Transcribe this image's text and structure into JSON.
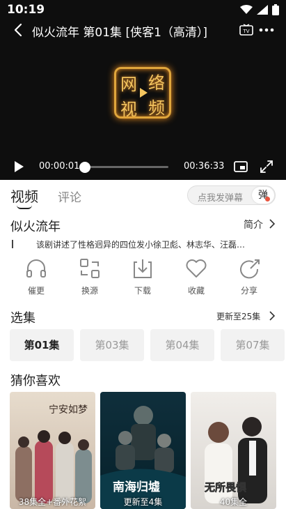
{
  "status_bar": {
    "time": "10:19"
  },
  "player": {
    "title": "似火流年 第01集 [侠客1（高清）]",
    "current_time": "00:00:01",
    "total_time": "00:36:33",
    "progress_fraction": 0.0,
    "logo_chars": [
      "网",
      "络",
      "视",
      "频"
    ]
  },
  "tabs": {
    "video": "视频",
    "comment": "评论"
  },
  "danmu": {
    "placeholder": "点我发弹幕",
    "toggle": "弹"
  },
  "show": {
    "name": "似火流年",
    "intro_label": "简介",
    "description": "该剧讲述了性格迥异的四位发小徐卫彪、林志华、汪磊…"
  },
  "actions": [
    {
      "label": "催更",
      "icon": "headphones-icon"
    },
    {
      "label": "换源",
      "icon": "switch-source-icon"
    },
    {
      "label": "下载",
      "icon": "download-icon"
    },
    {
      "label": "收藏",
      "icon": "heart-icon"
    },
    {
      "label": "分享",
      "icon": "share-icon"
    }
  ],
  "episodes": {
    "title": "选集",
    "updated": "更新至25集",
    "items": [
      "第01集",
      "第03集",
      "第04集",
      "第07集"
    ],
    "active_index": 0
  },
  "recommend": {
    "title": "猜你喜欢",
    "items": [
      {
        "caption": "38集全+番外花絮",
        "overlay_text": "宁安如梦"
      },
      {
        "caption": "更新至4集",
        "overlay_text": "南海归墟"
      },
      {
        "caption": "40集全",
        "overlay_text": "无所畏惧"
      }
    ]
  },
  "colors": {
    "accent_dot": "#e8553f",
    "logo_glow": "#f4c55f"
  }
}
